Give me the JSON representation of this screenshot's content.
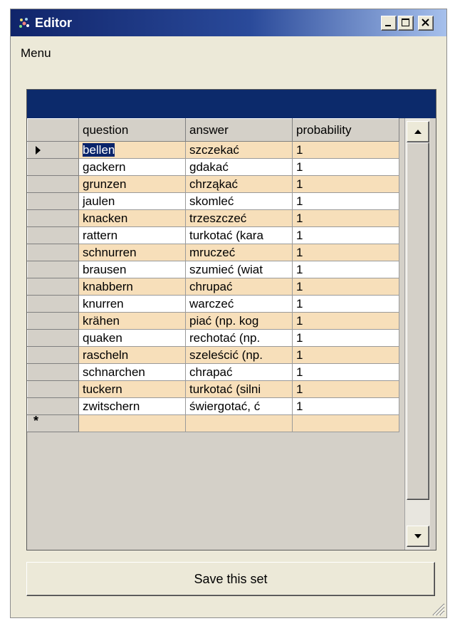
{
  "window": {
    "title": "Editor",
    "icon": "app-icon",
    "controls": {
      "minimize": "minimize-icon",
      "maximize": "maximize-icon",
      "close": "close-icon"
    }
  },
  "menu": {
    "items": [
      "Menu"
    ]
  },
  "grid": {
    "caption": "",
    "columns": [
      "question",
      "answer",
      "probability"
    ],
    "rows": [
      {
        "question": "bellen",
        "answer": "szczekać",
        "probability": "1"
      },
      {
        "question": "gackern",
        "answer": "gdakać",
        "probability": "1"
      },
      {
        "question": "grunzen",
        "answer": "chrząkać",
        "probability": "1"
      },
      {
        "question": "jaulen",
        "answer": "skomleć",
        "probability": "1"
      },
      {
        "question": "knacken",
        "answer": "trzeszczeć",
        "probability": "1"
      },
      {
        "question": "rattern",
        "answer": "turkotać (kara",
        "probability": "1"
      },
      {
        "question": "schnurren",
        "answer": "mruczeć",
        "probability": "1"
      },
      {
        "question": "brausen",
        "answer": "szumieć (wiat",
        "probability": "1"
      },
      {
        "question": "knabbern",
        "answer": "chrupać",
        "probability": "1"
      },
      {
        "question": "knurren",
        "answer": "warczeć",
        "probability": "1"
      },
      {
        "question": "krähen",
        "answer": "piać (np. kog",
        "probability": "1"
      },
      {
        "question": "quaken",
        "answer": "rechotać (np.",
        "probability": "1"
      },
      {
        "question": "rascheln",
        "answer": "szeleścić (np.",
        "probability": "1"
      },
      {
        "question": "schnarchen",
        "answer": "chrapać",
        "probability": "1"
      },
      {
        "question": "tuckern",
        "answer": "turkotać (silni",
        "probability": "1"
      },
      {
        "question": "zwitschern",
        "answer": "świergotać, ć",
        "probability": "1"
      }
    ],
    "new_row_marker": "*"
  },
  "save_button_label": "Save this set",
  "colors": {
    "alt_row": "#f7dfba",
    "title_bar": "#10246a",
    "caption": "#0c2a6b",
    "selection": "#0a246a"
  }
}
